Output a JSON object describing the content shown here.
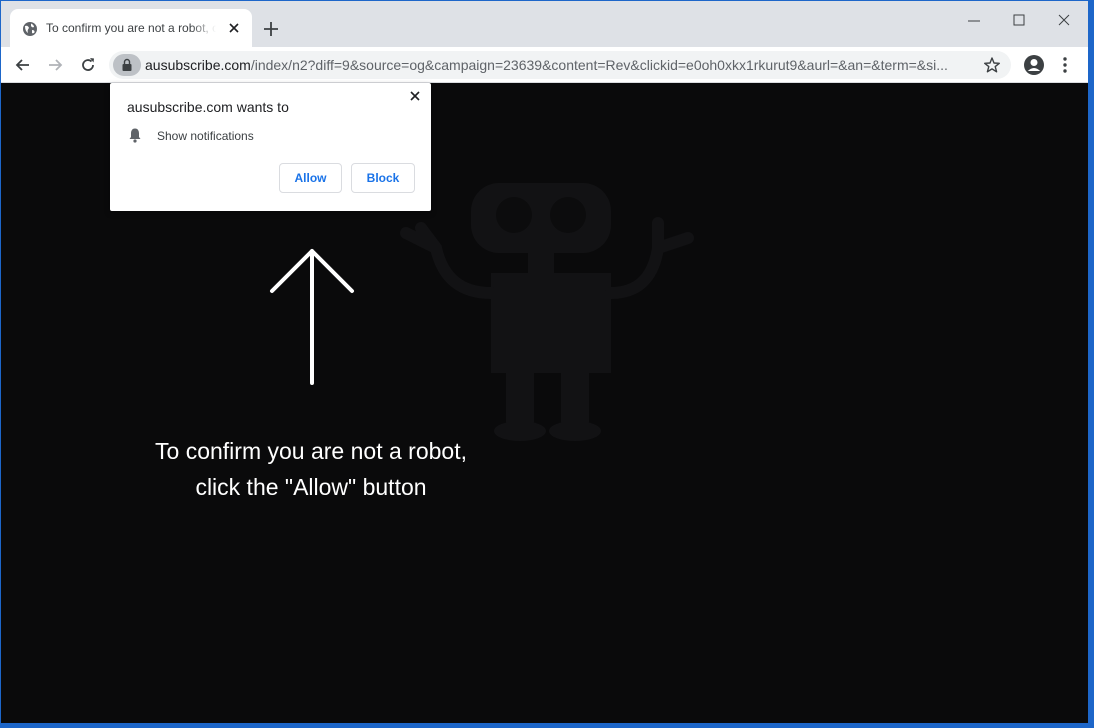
{
  "tab": {
    "title": "To confirm you are not a robot, click the \"Allow\" button",
    "favicon": "globe-icon"
  },
  "toolbar": {
    "url_host": "ausubscribe.com",
    "url_path": "/index/n2?diff=9&source=og&campaign=23639&content=Rev&clickid=e0oh0xkx1rkurut9&aurl=&an=&term=&si..."
  },
  "popup": {
    "title": "ausubscribe.com wants to",
    "permission": "Show notifications",
    "allow_label": "Allow",
    "block_label": "Block"
  },
  "page": {
    "message_line1": "To confirm you are not a robot,",
    "message_line2": "click the \"Allow\" button"
  },
  "colors": {
    "background": "#0a0a0b",
    "accent": "#1a73e8",
    "frame": "#1d66c9"
  }
}
